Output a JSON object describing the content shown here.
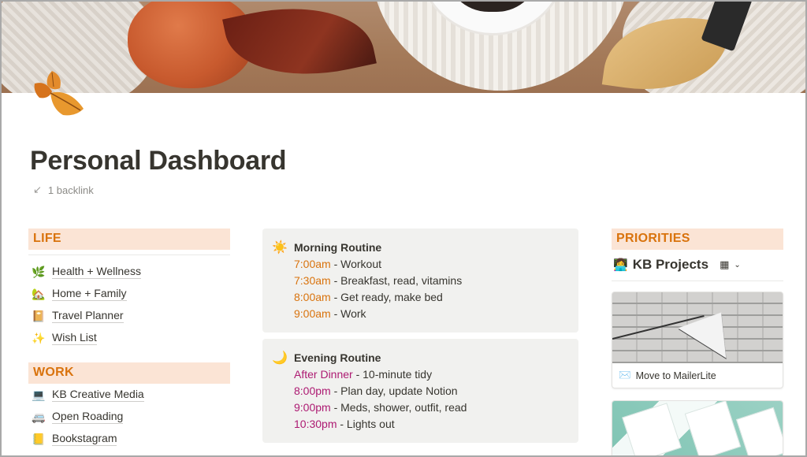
{
  "page": {
    "title": "Personal Dashboard",
    "backlink": "1 backlink"
  },
  "life": {
    "header": "LIFE",
    "items": [
      {
        "emoji": "🌿",
        "label": "Health + Wellness"
      },
      {
        "emoji": "🏡",
        "label": "Home + Family"
      },
      {
        "emoji": "📔",
        "label": "Travel Planner"
      },
      {
        "emoji": "✨",
        "label": "Wish List"
      }
    ]
  },
  "work": {
    "header": "WORK",
    "items": [
      {
        "emoji": "💻",
        "label": "KB Creative Media"
      },
      {
        "emoji": "🚐",
        "label": "Open Roading"
      },
      {
        "emoji": "📒",
        "label": "Bookstagram"
      }
    ]
  },
  "morning": {
    "emoji": "☀️",
    "title": "Morning Routine",
    "lines": [
      {
        "time": "7:00am",
        "text": " - Workout"
      },
      {
        "time": "7:30am",
        "text": " - Breakfast, read, vitamins"
      },
      {
        "time": "8:00am",
        "text": " - Get ready, make bed"
      },
      {
        "time": "9:00am",
        "text": " - Work"
      }
    ]
  },
  "evening": {
    "emoji": "🌙",
    "title": "Evening Routine",
    "lines": [
      {
        "time": "After Dinner",
        "text": " - 10-minute tidy"
      },
      {
        "time": "8:00pm",
        "text": " - Plan day, update Notion"
      },
      {
        "time": "9:00pm",
        "text": " - Meds, shower, outfit, read"
      },
      {
        "time": "10:30pm",
        "text": " - Lights out"
      }
    ]
  },
  "priorities": {
    "header": "PRIORITIES",
    "db_emoji": "👩‍💻",
    "db_title": "KB Projects",
    "cards": [
      {
        "emoji": "✉️",
        "label": "Move to MailerLite"
      }
    ]
  },
  "colors": {
    "accent_orange": "#d9730d",
    "accent_pink": "#ad1a72",
    "header_bg": "#fbe4d5",
    "callout_bg": "#f1f1ef"
  }
}
